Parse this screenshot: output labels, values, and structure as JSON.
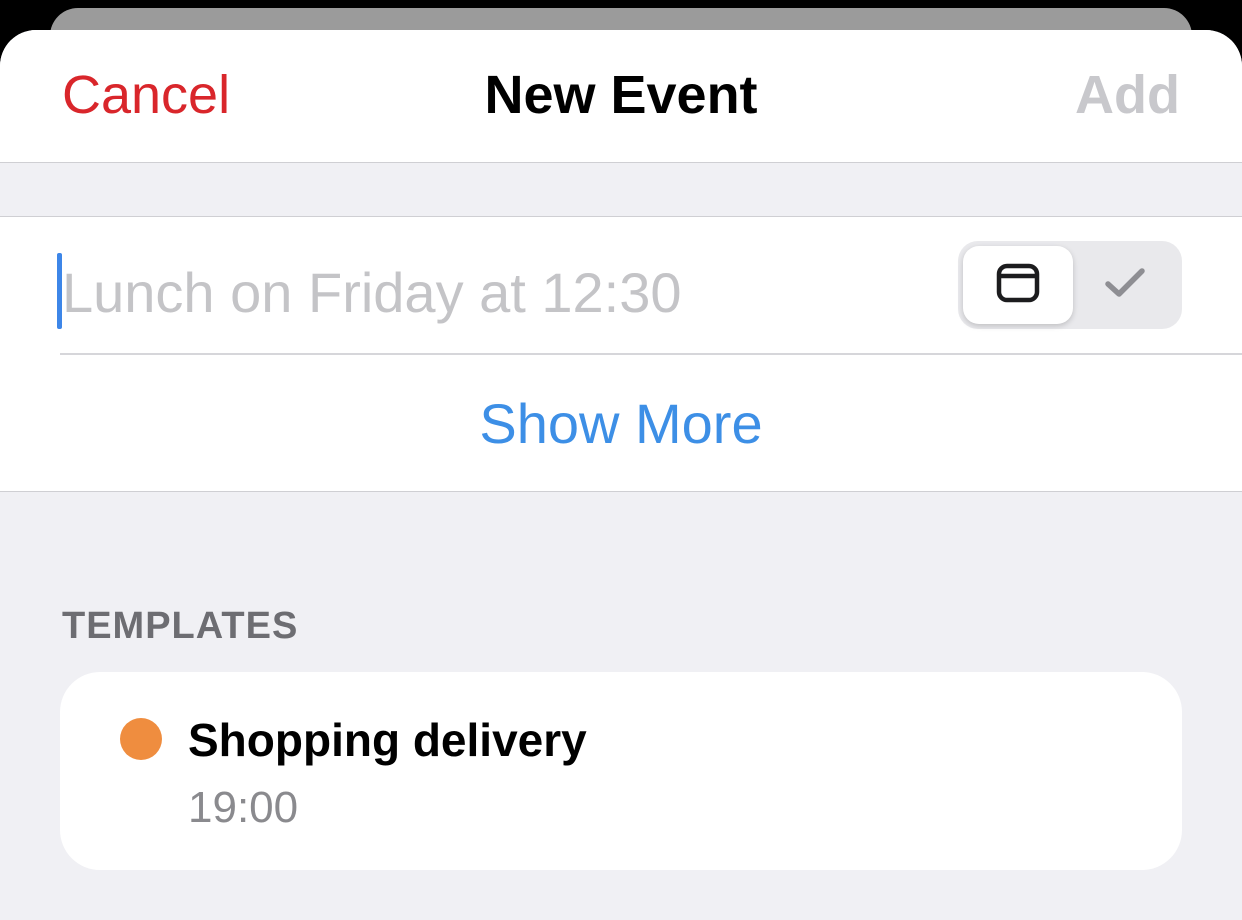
{
  "navbar": {
    "cancel_label": "Cancel",
    "title": "New Event",
    "add_label": "Add"
  },
  "input": {
    "placeholder": "Lunch on Friday at 12:30",
    "value": ""
  },
  "mode_toggle": {
    "options": [
      {
        "icon": "calendar-icon",
        "selected": true
      },
      {
        "icon": "checkmark-icon",
        "selected": false
      }
    ]
  },
  "show_more_label": "Show More",
  "templates": {
    "header": "TEMPLATES",
    "items": [
      {
        "title": "Shopping delivery",
        "time": "19:00",
        "color": "#ef8d3f"
      }
    ]
  },
  "colors": {
    "cancel": "#d9262b",
    "add_disabled": "#c8c8cc",
    "link": "#3d8fe6",
    "caret": "#3d86e8",
    "grouped_background": "#f0f0f4"
  }
}
